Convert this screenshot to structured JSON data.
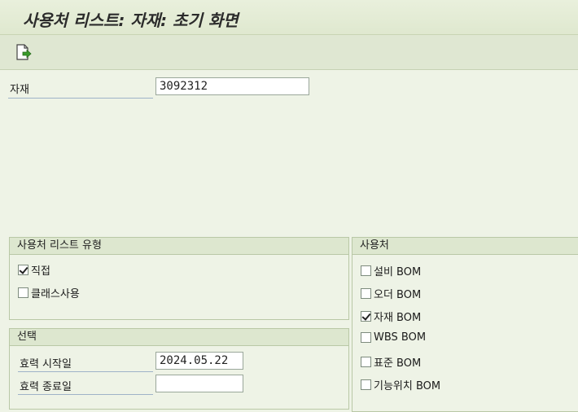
{
  "window": {
    "title": "사용처 리스트: 자재: 초기 화면"
  },
  "toolbar": {
    "execute_icon": "execute-document-icon"
  },
  "material": {
    "label": "자재",
    "value": "3092312"
  },
  "usage_type": {
    "title": "사용처 리스트 유형",
    "items": [
      {
        "label": "직접",
        "checked": true
      },
      {
        "label": "클래스사용",
        "checked": false
      }
    ]
  },
  "selection": {
    "title": "선택",
    "valid_from_label": "효력 시작일",
    "valid_from_value": "2024.05.22",
    "valid_to_label": "효력 종료일",
    "valid_to_value": ""
  },
  "used_in": {
    "title": "사용처",
    "items": [
      {
        "label": "설비 BOM",
        "checked": false
      },
      {
        "label": "오더 BOM",
        "checked": false
      },
      {
        "label": "자재 BOM",
        "checked": true
      },
      {
        "label": "WBS BOM",
        "checked": false
      },
      {
        "label": "표준 BOM",
        "checked": false
      },
      {
        "label": "기능위치 BOM",
        "checked": false
      }
    ]
  }
}
